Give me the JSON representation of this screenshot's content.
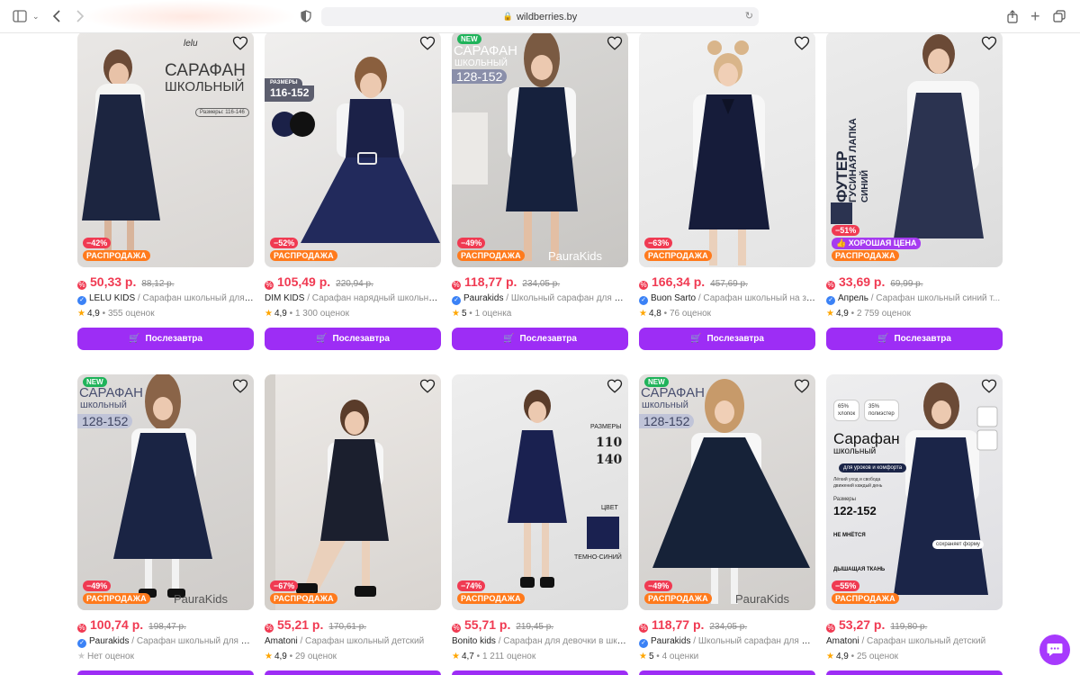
{
  "browser": {
    "url": "wildberries.by"
  },
  "labels": {
    "buy": "Послезавтра",
    "sale": "РАСПРОДАЖА",
    "new": "NEW",
    "good_price": "ХОРОШАЯ ЦЕНА"
  },
  "colors": {
    "accent": "#9d2df5",
    "price": "#f03a52",
    "sale_badge": "#ff7a1c",
    "new_badge": "#1fb35a",
    "verified": "#3b82f6"
  },
  "products": [
    {
      "brand": "LELU KIDS",
      "name": "Сарафан школьный для д...",
      "price": "50,33 р.",
      "old_price": "88,12 р.",
      "discount": "−42%",
      "rating": "4,9",
      "reviews": "355 оценок",
      "verified": true,
      "new": false,
      "overlay": [
        "САРАФАН",
        "ШКОЛЬНЫЙ",
        "Размеры: 116-146"
      ],
      "logo": "lelu"
    },
    {
      "brand": "DIM KIDS",
      "name": "Сарафан нарядный школьна...",
      "price": "105,49 р.",
      "old_price": "220,94 р.",
      "discount": "−52%",
      "rating": "4,9",
      "reviews": "1 300 оценок",
      "verified": false,
      "new": false,
      "overlay": [
        "РАЗМЕРЫ",
        "116-152"
      ]
    },
    {
      "brand": "Paurakids",
      "name": "Школьный сарафан для де...",
      "price": "118,77 р.",
      "old_price": "234,05 р.",
      "discount": "−49%",
      "rating": "5",
      "reviews": "1 оценка",
      "verified": true,
      "new": true,
      "overlay": [
        "САРАФАН",
        "ШКОЛЬНЫЙ",
        "128-152",
        "PauraKids"
      ]
    },
    {
      "brand": "Buon Sarto",
      "name": "Сарафан школьный на за...",
      "price": "166,34 р.",
      "old_price": "457,69 р.",
      "discount": "−63%",
      "rating": "4,8",
      "reviews": "76 оценок",
      "verified": true,
      "new": false,
      "overlay": []
    },
    {
      "brand": "Апрель",
      "name": "Сарафан школьный синий т...",
      "price": "33,69 р.",
      "old_price": "69,99 р.",
      "discount": "−51%",
      "rating": "4,9",
      "reviews": "2 759 оценок",
      "verified": true,
      "new": false,
      "good_price": true,
      "overlay": [
        "ФУТЕР",
        "ГУСИНАЯ ЛАПКА",
        "СИНИЙ"
      ]
    },
    {
      "brand": "Paurakids",
      "name": "Сарафан школьный для де...",
      "price": "100,74 р.",
      "old_price": "198,47 р.",
      "discount": "−49%",
      "rating": "",
      "reviews": "Нет оценок",
      "verified": true,
      "new": true,
      "overlay": [
        "САРАФАН",
        "школьный",
        "128-152",
        "PauraKids"
      ]
    },
    {
      "brand": "Amatoni",
      "name": "Сарафан школьный детский",
      "price": "55,21 р.",
      "old_price": "170,61 р.",
      "discount": "−67%",
      "rating": "4,9",
      "reviews": "29 оценок",
      "verified": false,
      "new": false,
      "overlay": []
    },
    {
      "brand": "Bonito kids",
      "name": "Сарафан для девочки в шко...",
      "price": "55,71 р.",
      "old_price": "219,45 р.",
      "discount": "−74%",
      "rating": "4,7",
      "reviews": "1 211 оценок",
      "verified": false,
      "new": false,
      "overlay": [
        "РАЗМЕРЫ",
        "110",
        "140",
        "ЦВЕТ",
        "ТЕМНО-СИНИЙ"
      ]
    },
    {
      "brand": "Paurakids",
      "name": "Школьный сарафан для де...",
      "price": "118,77 р.",
      "old_price": "234,05 р.",
      "discount": "−49%",
      "rating": "5",
      "reviews": "4 оценки",
      "verified": true,
      "new": true,
      "overlay": [
        "САРАФАН",
        "школьный",
        "128-152",
        "PauraKids"
      ]
    },
    {
      "brand": "Amatoni",
      "name": "Сарафан школьный детский",
      "price": "53,27 р.",
      "old_price": "119,80 р.",
      "discount": "−55%",
      "rating": "4,9",
      "reviews": "25 оценок",
      "verified": false,
      "new": false,
      "overlay": [
        "65%",
        "хлопок",
        "35%",
        "полиэстер",
        "Сарафан",
        "школьный",
        "для уроков и комфорта",
        "Лёгкий уход и свобода движений каждый день",
        "Размеры",
        "122-152",
        "НЕ МНЁТСЯ",
        "ДЫШАЩАЯ ТКАНЬ",
        "сохраняет форму"
      ]
    }
  ]
}
